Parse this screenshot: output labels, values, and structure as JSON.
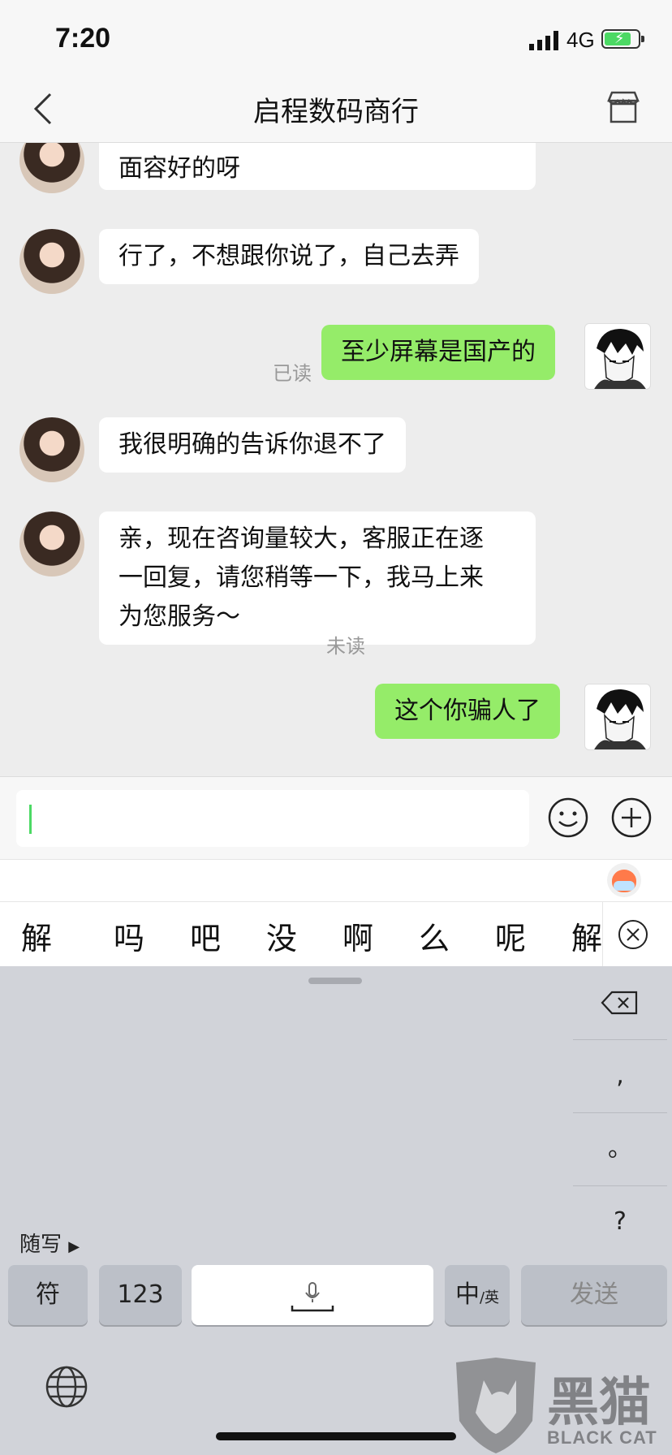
{
  "status_bar": {
    "time": "7:20",
    "network": "4G"
  },
  "nav": {
    "title": "启程数码商行"
  },
  "messages": [
    {
      "side": "in",
      "text": "面容好的呀"
    },
    {
      "side": "in",
      "text": "行了，不想跟你说了，自己去弄"
    },
    {
      "side": "out",
      "text": "至少屏幕是国产的",
      "status": "已读"
    },
    {
      "side": "in",
      "text": "我很明确的告诉你退不了"
    },
    {
      "side": "in",
      "line1": "亲，现在咨询量较大，客服正在逐",
      "line2": "一回复，请您稍等一下，我马上来",
      "line3": "为您服务～"
    },
    {
      "side": "out",
      "text": "这个你骗人了",
      "status": "未读"
    }
  ],
  "candidates": [
    "解",
    "吗",
    "吧",
    "没",
    "啊",
    "么",
    "呢",
    "解"
  ],
  "keyboard": {
    "side_keys": [
      ",",
      "。",
      "?"
    ],
    "handwrite_label": "随写",
    "symbols_key": "符",
    "numbers_key": "123",
    "lang_key_main": "中",
    "lang_key_sub": "/英",
    "send_key": "发送"
  },
  "watermark": {
    "main": "黑猫",
    "sub": "BLACK CAT"
  },
  "colors": {
    "outgoing_bubble": "#95ec69",
    "incoming_bubble": "#ffffff",
    "background": "#ededed",
    "caret": "#4cd964"
  }
}
